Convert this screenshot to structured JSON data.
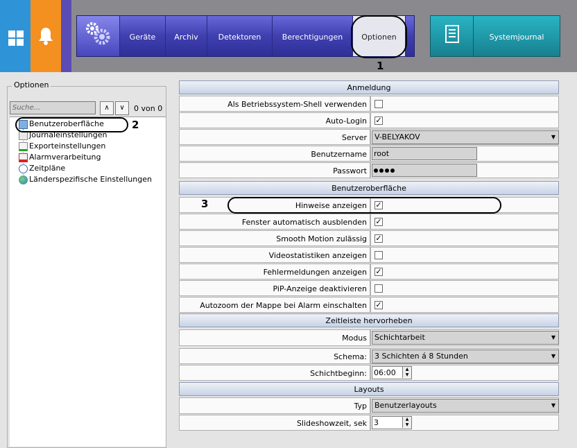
{
  "topbar": {
    "nav_items": [
      "Geräte",
      "Archiv",
      "Detektoren",
      "Berechtigungen",
      "Optionen"
    ],
    "journal_label": "Systemjournal",
    "colors": {
      "windows": "#2f93d8",
      "bell": "#f3901f",
      "nav": "#4747bd",
      "journal": "#17808f"
    }
  },
  "annotations": {
    "one": "1",
    "two": "2",
    "three": "3"
  },
  "left_panel": {
    "group_title": "Optionen",
    "search_placeholder": "Suche...",
    "up_arrow": "∧",
    "down_arrow": "∨",
    "counter": "0 von 0",
    "tree": [
      "Benutzeroberfläche",
      "Journaleinstellungen",
      "Exporteinstellungen",
      "Alarmverarbeitung",
      "Zeitpläne",
      "Länderspezifische Einstellungen"
    ]
  },
  "settings": {
    "anmeldung": {
      "title": "Anmeldung",
      "shell_label": "Als Betriebssystem-Shell verwenden",
      "shell_checked": false,
      "autologin_label": "Auto-Login",
      "autologin_checked": true,
      "server_label": "Server",
      "server_value": "V-BELYAKOV",
      "username_label": "Benutzername",
      "username_value": "root",
      "password_label": "Passwort",
      "password_length": 4
    },
    "ui": {
      "title": "Benutzeroberfläche",
      "rows": [
        {
          "label": "Hinweise anzeigen",
          "checked": true
        },
        {
          "label": "Fenster automatisch ausblenden",
          "checked": true
        },
        {
          "label": "Smooth Motion zulässig",
          "checked": true
        },
        {
          "label": "Videostatistiken anzeigen",
          "checked": false
        },
        {
          "label": "Fehlermeldungen anzeigen",
          "checked": true
        },
        {
          "label": "PiP-Anzeige deaktivieren",
          "checked": false
        },
        {
          "label": "Autozoom der Mappe bei Alarm einschalten",
          "checked": true
        }
      ]
    },
    "timeline": {
      "title": "Zeitleiste hervorheben",
      "mode_label": "Modus",
      "mode_value": "Schichtarbeit",
      "schema_label": "Schema:",
      "schema_value": "3 Schichten á 8 Stunden",
      "start_label": "Schichtbeginn:",
      "start_value": "06:00"
    },
    "layouts": {
      "title": "Layouts",
      "type_label": "Typ",
      "type_value": "Benutzerlayouts",
      "slideshow_label": "Slideshowzeit, sek",
      "slideshow_value": "3"
    }
  }
}
